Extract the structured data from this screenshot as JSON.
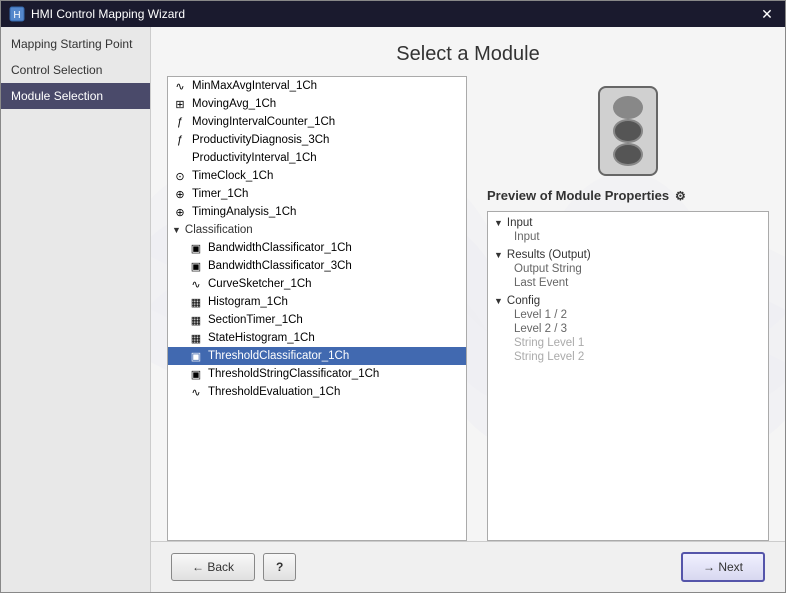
{
  "window": {
    "title": "HMI Control Mapping Wizard",
    "close_label": "✕"
  },
  "sidebar": {
    "items": [
      {
        "label": "Mapping Starting Point",
        "active": false
      },
      {
        "label": "Control Selection",
        "active": false
      },
      {
        "label": "Module Selection",
        "active": true
      }
    ]
  },
  "main": {
    "page_title": "Select a Module",
    "module_list": {
      "items": [
        {
          "type": "icon-item",
          "icon": "∿",
          "label": "MinMaxAvgInterval_1Ch"
        },
        {
          "type": "icon-item",
          "icon": "⊞",
          "label": "MovingAvg_1Ch"
        },
        {
          "type": "icon-item",
          "icon": "ƒ",
          "label": "MovingIntervalCounter_1Ch"
        },
        {
          "type": "icon-item",
          "icon": "ƒ",
          "label": "ProductivityDiagnosis_3Ch"
        },
        {
          "type": "plain-item",
          "label": "ProductivityInterval_1Ch"
        },
        {
          "type": "icon-item",
          "icon": "⊙",
          "label": "TimeClock_1Ch"
        },
        {
          "type": "icon-item",
          "icon": "⊕",
          "label": "Timer_1Ch"
        },
        {
          "type": "icon-item",
          "icon": "⊕",
          "label": "TimingAnalysis_1Ch"
        },
        {
          "type": "category",
          "label": "Classification",
          "expanded": true
        },
        {
          "type": "icon-item",
          "icon": "▣",
          "label": "BandwidthClassificator_1Ch",
          "indent": true
        },
        {
          "type": "icon-item",
          "icon": "▣",
          "label": "BandwidthClassificator_3Ch",
          "indent": true
        },
        {
          "type": "icon-item",
          "icon": "∿",
          "label": "CurveSketcher_1Ch",
          "indent": true
        },
        {
          "type": "icon-item",
          "icon": "▦",
          "label": "Histogram_1Ch",
          "indent": true
        },
        {
          "type": "icon-item",
          "icon": "▦",
          "label": "SectionTimer_1Ch",
          "indent": true
        },
        {
          "type": "icon-item",
          "icon": "▦",
          "label": "StateHistogram_1Ch",
          "indent": true
        },
        {
          "type": "icon-item",
          "icon": "▣",
          "label": "ThresholdClassificator_1Ch",
          "indent": true,
          "highlighted": true
        },
        {
          "type": "icon-item",
          "icon": "▣",
          "label": "ThresholdStringClassificator_1Ch",
          "indent": true
        },
        {
          "type": "icon-item",
          "icon": "∿",
          "label": "ThresholdEvaluation_1Ch",
          "indent": true,
          "partial": true
        }
      ]
    },
    "preview": {
      "title": "Preview of Module Properties",
      "properties": {
        "groups": [
          {
            "name": "Input",
            "expanded": true,
            "items": [
              "Input"
            ]
          },
          {
            "name": "Results (Output)",
            "expanded": true,
            "items": [
              "Output String",
              "Last Event"
            ]
          },
          {
            "name": "Config",
            "expanded": true,
            "items": [
              "Level 1 / 2",
              "Level 2 / 3",
              "String Level 1",
              "String Level 2"
            ]
          }
        ]
      }
    }
  },
  "buttons": {
    "back_label": "← Back",
    "help_label": "?",
    "next_label": "→ Next"
  }
}
